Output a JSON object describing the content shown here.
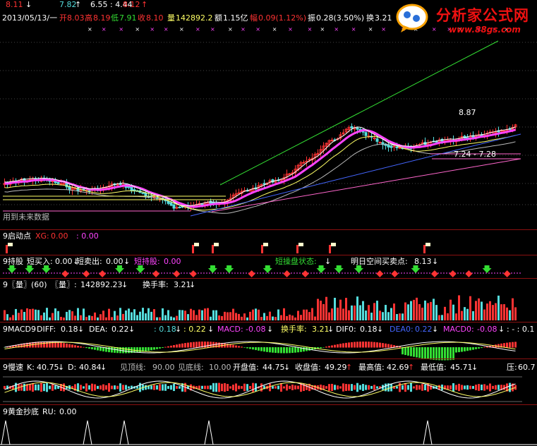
{
  "colors": {
    "up": "#ff3333",
    "down": "#55dddd",
    "bg": "#000000",
    "label_white": "#ffffff",
    "magenta": "#ff44ff",
    "yellow": "#ffff66",
    "green": "#33dd33",
    "blue": "#4466ff"
  },
  "top_values": {
    "v1": "8.11",
    "v2": "7.82",
    "v3": "6.55 : 4.44",
    "v4": "8.12"
  },
  "quote": {
    "date": "2013/05/13/一",
    "open_lbl": "开",
    "open": "8.03",
    "high_lbl": "高",
    "high": "8.19",
    "low_lbl": "低",
    "low": "7.91",
    "close_lbl": "收",
    "close": "8.10",
    "vol_lbl": "量",
    "vol": "142892.2",
    "amt_lbl": "额",
    "amt": "1.15亿",
    "chg_lbl": "幅",
    "chg": "0.09(1.12%)",
    "amp_lbl": "振",
    "amp": "0.28(3.50%)",
    "turn_lbl": "换",
    "turn": "3.21"
  },
  "main": {
    "high_label": "8.87",
    "range_label": "7.24 - 7.28",
    "watermark": "用到未来数据"
  },
  "panel1": {
    "title": "9启动点",
    "xg_lbl": "XG:",
    "xg": "0.00",
    "v2": ": 0.00"
  },
  "panel2": {
    "title": "9持股",
    "buy_lbl": "短买入:",
    "buy": "0.00",
    "sell_lbl": "短卖出:",
    "sell": "0.00",
    "hold_lbl": "短持股:",
    "hold": "0.00",
    "state_lbl": "短操盘状态:",
    "state": "",
    "tomorrow_lbl": "明日空间买卖点:",
    "tomorrow": "8.13"
  },
  "panel3": {
    "title": "9〖量〗(60)",
    "vol_lbl": "〖量〗:",
    "vol": "142892.23",
    "turn_lbl": "换手率:",
    "turn": "3.21"
  },
  "panel4": {
    "title": "9MACD9",
    "diff_lbl": "DIFF:",
    "diff": "0.18",
    "dea_lbl": "DEA:",
    "dea": "0.22",
    "a": ": 0.18",
    "b": ": 0.22",
    "macd_lbl": "MACD:",
    "macd": "-0.08",
    "turn_lbl": "换手率:",
    "turn": "3.21",
    "dif0_lbl": "DIF0:",
    "dif0": "0.18",
    "dea0_lbl": "DEA0:",
    "dea0": "0.22",
    "macd0_lbl": "MACD0:",
    "macd0": "-0.08",
    "tail": ": - : 0.1"
  },
  "panel5": {
    "title": "9慢速",
    "k_lbl": "K:",
    "k": "40.75",
    "d_lbl": "D:",
    "d": "40.84",
    "top_lbl": "见顶线:",
    "top": "90.00",
    "bottom_lbl": "见底线:",
    "bottom": "10.00",
    "open_lbl": "开盘值:",
    "open": "44.75",
    "close_lbl": "收盘值:",
    "close": "49.29",
    "max_lbl": "最高值:",
    "max": "42.69",
    "min_lbl": "最低值:",
    "min": "45.71",
    "press_lbl": "压:",
    "press": "60.7"
  },
  "panel6": {
    "title": "9黄金抄底",
    "ru_lbl": "RU:",
    "ru": "0.00"
  },
  "logo": {
    "name": "分析家公式网",
    "url": "www.88gs.com"
  }
}
